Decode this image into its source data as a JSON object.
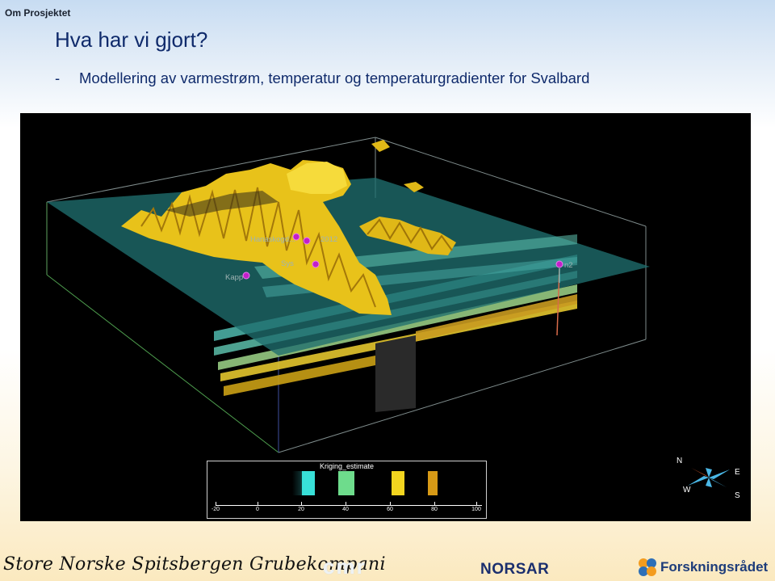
{
  "header": {
    "label": "Om Prosjektet"
  },
  "slide": {
    "title": "Hva har vi gjort?",
    "bullet_dash": "-",
    "bullet_text": "Modellering av varmestrøm, temperatur og temperaturgradienter for Svalbard"
  },
  "visualization": {
    "points": [
      {
        "label": "Hanaskogd..."
      },
      {
        "label": "2012"
      },
      {
        "label": "Sys"
      },
      {
        "label": "Kapp"
      },
      {
        "label": "n2"
      }
    ],
    "legend": {
      "title": "Kriging_estimate",
      "ticks": [
        "-20",
        "0",
        "20",
        "40",
        "60",
        "80",
        "100"
      ]
    },
    "compass": {
      "n": "N",
      "e": "E",
      "s": "S",
      "w": "W"
    },
    "colors": {
      "water": "#1f6e6e",
      "terrain": "#e8c21a",
      "marker": "#c21fc9"
    }
  },
  "footer": {
    "sng": "Store Norske Spitsbergen Grubekompani",
    "cmr": "cmr",
    "norsar": "NORSAR",
    "forskningsradet": "Forskningsrådet"
  }
}
